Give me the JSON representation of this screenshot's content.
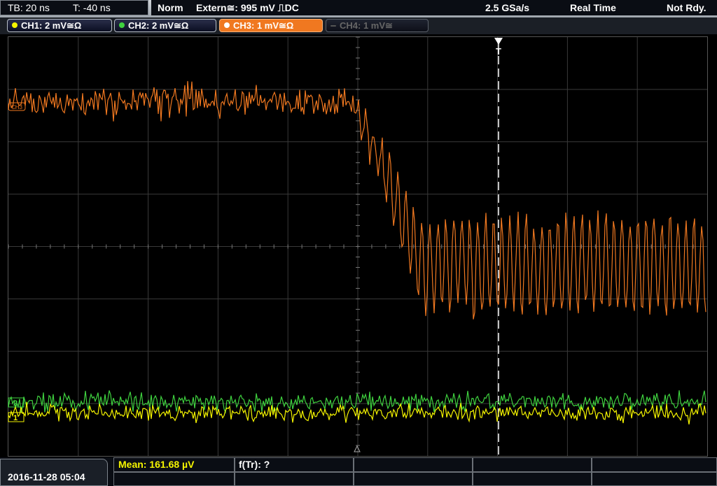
{
  "timebase": {
    "tb": "TB: 20 ns",
    "trigger_pos": "T: -40 ns"
  },
  "status": {
    "mode": "Norm",
    "trigger_source": "Extern≅: 995 mV ⎍DC",
    "sample_rate": "2.5 GSa/s",
    "acq_mode": "Real Time",
    "state": "Not Rdy."
  },
  "channels": [
    {
      "label": "CH1: 2 mV≅Ω",
      "color": "#f5f500",
      "active": false,
      "enabled": true
    },
    {
      "label": "CH2: 2 mV≅Ω",
      "color": "#3fd23f",
      "active": false,
      "enabled": true
    },
    {
      "label": "CH3: 1 mV≅Ω",
      "color": "#f07820",
      "active": true,
      "enabled": true
    },
    {
      "label": "CH4: 1 mV≅",
      "color": "#666666",
      "active": false,
      "enabled": false
    }
  ],
  "markers": {
    "ch3": "CH3",
    "ch1": "1",
    "ch2": "2",
    "trigger": "T"
  },
  "waveforms": {
    "colors": {
      "ch1": "#f5f500",
      "ch2": "#3fd23f",
      "ch3": "#f07820",
      "grid": "#3a3a3a",
      "cursor": "#ffffff"
    },
    "ch3_trace": "noisy falling edge near center with ringing",
    "ch1_trace": "baseline noise",
    "ch2_trace": "baseline noise"
  },
  "datetime": "2016-11-28 05:04",
  "measurements": {
    "mean": "Mean: 161.68 µV",
    "ftr": "f(Tr): ?"
  }
}
